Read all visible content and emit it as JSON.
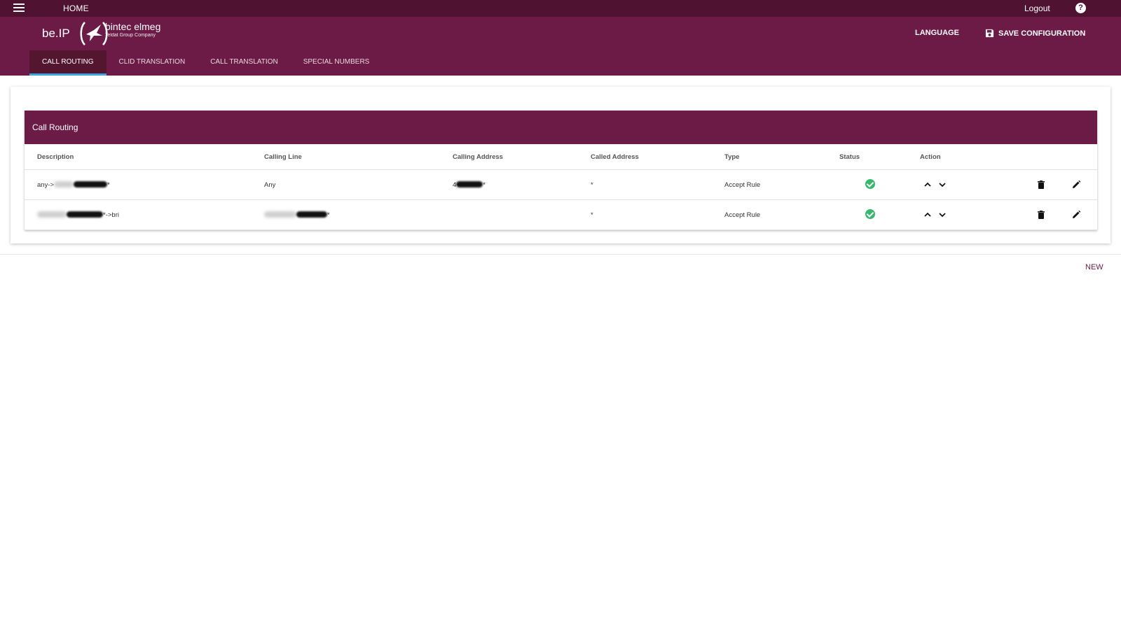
{
  "topbar": {
    "home": "HOME",
    "logout": "Logout",
    "help": "?"
  },
  "header": {
    "brand": "be.IP",
    "logo_text": "bintec elmeg",
    "logo_sub": "Teldat Group Company",
    "language": "LANGUAGE",
    "save": "SAVE CONFIGURATION"
  },
  "tabs": [
    "CALL ROUTING",
    "CLID TRANSLATION",
    "CALL TRANSLATION",
    "SPECIAL NUMBERS"
  ],
  "panel": {
    "title": "Call Routing",
    "columns": [
      "Description",
      "Calling Line",
      "Calling Address",
      "Called Address",
      "Type",
      "Status",
      "Action"
    ],
    "rows": [
      {
        "desc_prefix": "any->",
        "desc_suffix": "*",
        "calling_line": "Any",
        "calling_address": "4",
        "called_address": "*",
        "type": "Accept Rule",
        "status": "active"
      },
      {
        "desc_prefix": "",
        "desc_suffix": "*->bri",
        "calling_line": "",
        "calling_line_suffix": "*",
        "calling_address": "",
        "called_address": "*",
        "type": "Accept Rule",
        "status": "active"
      }
    ]
  },
  "footer": {
    "new": "NEW"
  },
  "colors": {
    "topbar": "#4f1331",
    "header": "#6b1b45",
    "tab_indicator": "#3aa5e0",
    "ok": "#36b96a"
  }
}
